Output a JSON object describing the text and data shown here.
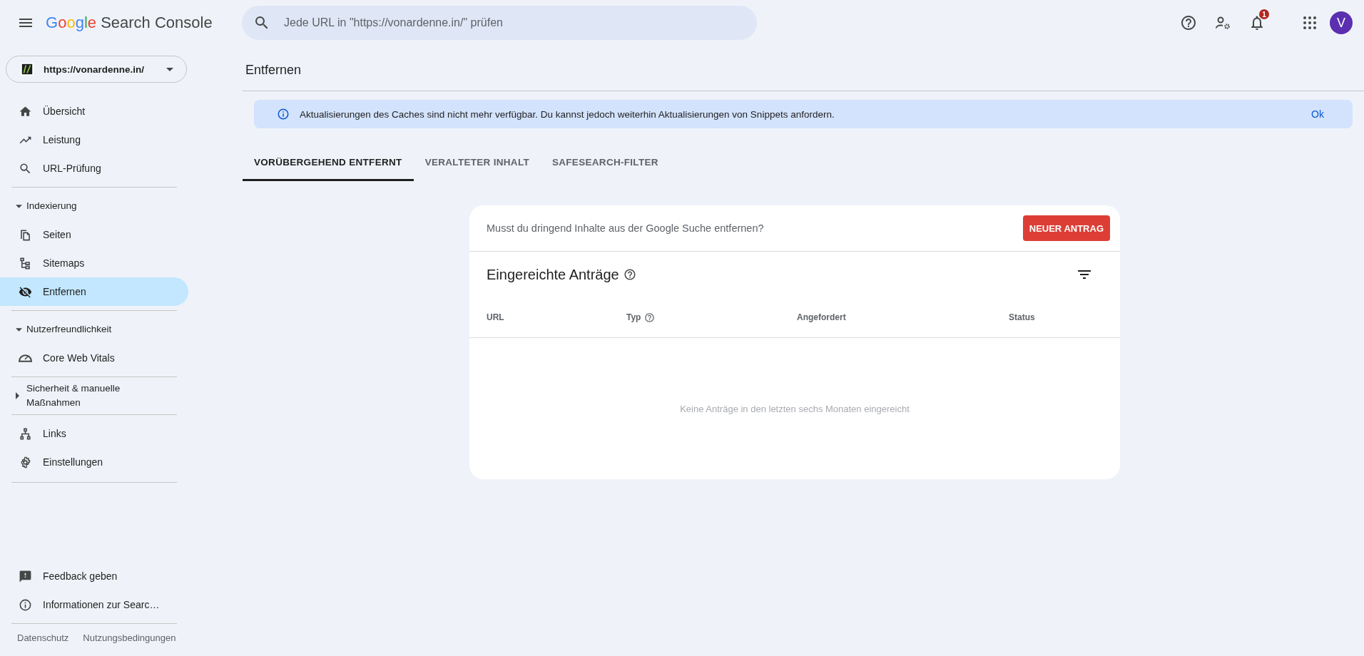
{
  "header": {
    "logo": {
      "brand": "Google",
      "product": "Search Console"
    },
    "search": {
      "placeholder": "Jede URL in \"https://vonardenne.in/\" prüfen"
    },
    "notification_count": "1",
    "avatar": "V"
  },
  "sidebar": {
    "property": {
      "url": "https://vonardenne.in/"
    },
    "sections": [
      {
        "items": [
          {
            "label": "Übersicht",
            "selected": false
          },
          {
            "label": "Leistung",
            "selected": false
          },
          {
            "label": "URL-Prüfung",
            "selected": false
          }
        ]
      },
      {
        "title": "Indexierung",
        "expanded": true,
        "items": [
          {
            "label": "Seiten",
            "selected": false
          },
          {
            "label": "Sitemaps",
            "selected": false
          },
          {
            "label": "Entfernen",
            "selected": true
          }
        ]
      },
      {
        "title": "Nutzerfreundlichkeit",
        "expanded": true,
        "items": [
          {
            "label": "Core Web Vitals",
            "selected": false
          }
        ]
      },
      {
        "title": "Sicherheit & manuelle Maßnahmen",
        "expanded": false
      },
      {
        "items": [
          {
            "label": "Links",
            "selected": false
          },
          {
            "label": "Einstellungen",
            "selected": false
          }
        ]
      }
    ],
    "bottom_items": [
      {
        "label": "Feedback geben",
        "selected": false
      },
      {
        "label": "Informationen zur Searc…",
        "selected": false
      }
    ],
    "footer_links": [
      "Datenschutz",
      "Nutzungsbedingungen"
    ]
  },
  "main": {
    "page_title": "Entfernen",
    "banner": {
      "message": "Aktualisierungen des Caches sind nicht mehr verfügbar. Du kannst jedoch weiterhin Aktualisierungen von Snippets anfordern.",
      "action": "Ok"
    },
    "tabs": [
      {
        "label": "VORÜBERGEHEND ENTFERNT",
        "selected": true
      },
      {
        "label": "VERALTETER INHALT",
        "selected": false
      },
      {
        "label": "SAFESEARCH-FILTER",
        "selected": false
      }
    ],
    "card": {
      "prompt": "Musst du dringend Inhalte aus der Google Suche entfernen?",
      "button": "NEUER ANTRAG",
      "table_title": "Eingereichte Anträge",
      "columns": [
        {
          "label": "URL",
          "help": false
        },
        {
          "label": "Typ",
          "help": true
        },
        {
          "label": "Angefordert",
          "help": false
        },
        {
          "label": "Status",
          "help": false
        }
      ],
      "empty_message": "Keine Anträge in den letzten sechs Monaten eingereicht"
    }
  }
}
